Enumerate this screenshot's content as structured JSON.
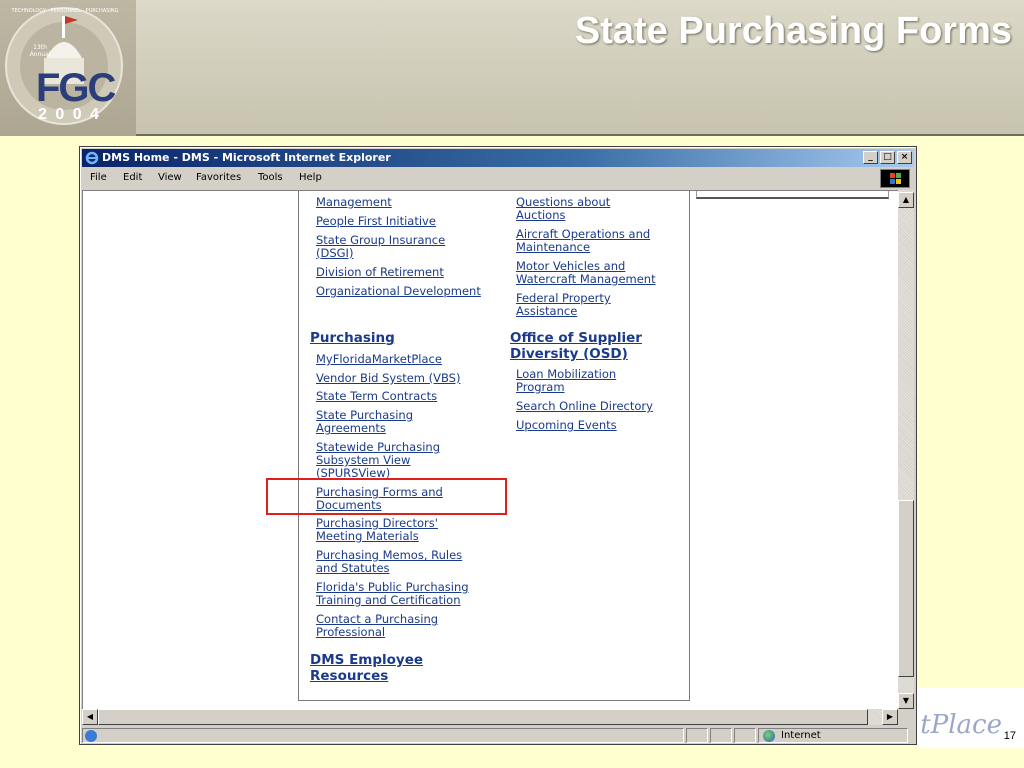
{
  "slide": {
    "title": "State Purchasing Forms",
    "page_number": "17",
    "logo": {
      "text_main": "FGC",
      "text_year": "2 0 0 4",
      "ring_text": "TECHNOLOGY · PERSONNEL · PURCHASING",
      "badge": "13th Annual"
    },
    "corner_decoration_text": "tPlace"
  },
  "browser": {
    "title": "DMS Home - DMS - Microsoft Internet Explorer",
    "menu": [
      "File",
      "Edit",
      "View",
      "Favorites",
      "Tools",
      "Help"
    ],
    "status_zone": "Internet",
    "window_buttons": {
      "minimize": "_",
      "maximize": "□",
      "close": "×"
    }
  },
  "page": {
    "left_column": {
      "links_top": [
        "Management",
        "People First Initiative",
        "State Group Insurance\n(DSGI)",
        "Division of Retirement",
        "Organizational Development"
      ],
      "purchasing_heading": "Purchasing",
      "purchasing_links": [
        "MyFloridaMarketPlace",
        "Vendor Bid System (VBS)",
        "State Term Contracts",
        "State Purchasing\nAgreements",
        "Statewide Purchasing\nSubsystem View\n(SPURSView)",
        "Purchasing Forms and\nDocuments",
        "Purchasing Directors'\nMeeting Materials",
        "Purchasing Memos, Rules\nand Statutes",
        "Florida's Public Purchasing\nTraining and Certification",
        "Contact a Purchasing\nProfessional"
      ],
      "employee_heading": "DMS Employee\nResources"
    },
    "right_column": {
      "links_top": [
        "Questions about\nAuctions",
        "Aircraft Operations and\nMaintenance",
        "Motor Vehicles and\nWatercraft Management",
        "Federal Property\nAssistance"
      ],
      "osd_heading": "Office of Supplier\nDiversity (OSD)",
      "osd_links": [
        "Loan Mobilization\nProgram",
        "Search Online Directory",
        "Upcoming Events"
      ]
    },
    "highlighted_link": "Purchasing Forms and\nDocuments",
    "colors": {
      "link": "#1a3a8a",
      "highlight_box": "#e0201c",
      "slide_bg": "#ffffd0"
    }
  }
}
